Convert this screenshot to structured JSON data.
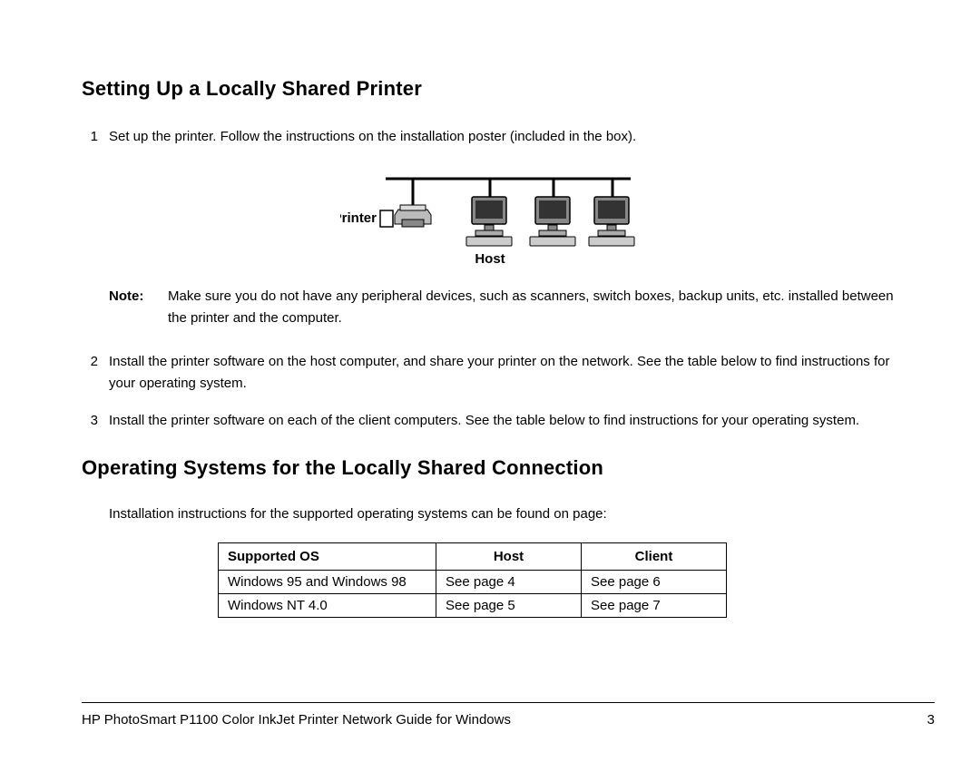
{
  "heading1": "Setting Up a Locally Shared Printer",
  "steps": {
    "s1num": "1",
    "s1text": "Set up the printer. Follow the instructions on the installation poster (included in the box).",
    "note_label": "Note:",
    "note_text": "Make sure you do not have any peripheral devices, such as scanners, switch boxes, backup units, etc. installed between the printer and the computer.",
    "s2num": "2",
    "s2text": "Install the printer software on the host computer, and share your printer on the network. See the table below to find instructions for your operating system.",
    "s3num": "3",
    "s3text": "Install the printer software on each of the client computers. See the table below to find instructions for your operating system."
  },
  "heading2": "Operating Systems for the Locally Shared Connection",
  "intro": "Installation instructions for the supported operating systems can be found on page:",
  "diagram": {
    "label_printer": "Printer",
    "label_host": "Host"
  },
  "table": {
    "headers": {
      "os": "Supported OS",
      "host": "Host",
      "client": "Client"
    },
    "rows": [
      {
        "os": "Windows 95 and Windows 98",
        "host": "See page 4",
        "client": "See page 6"
      },
      {
        "os": "Windows NT 4.0",
        "host": "See page 5",
        "client": "See page 7"
      }
    ]
  },
  "footer": {
    "title": "HP PhotoSmart P1100 Color InkJet Printer Network Guide for Windows",
    "page": "3"
  }
}
